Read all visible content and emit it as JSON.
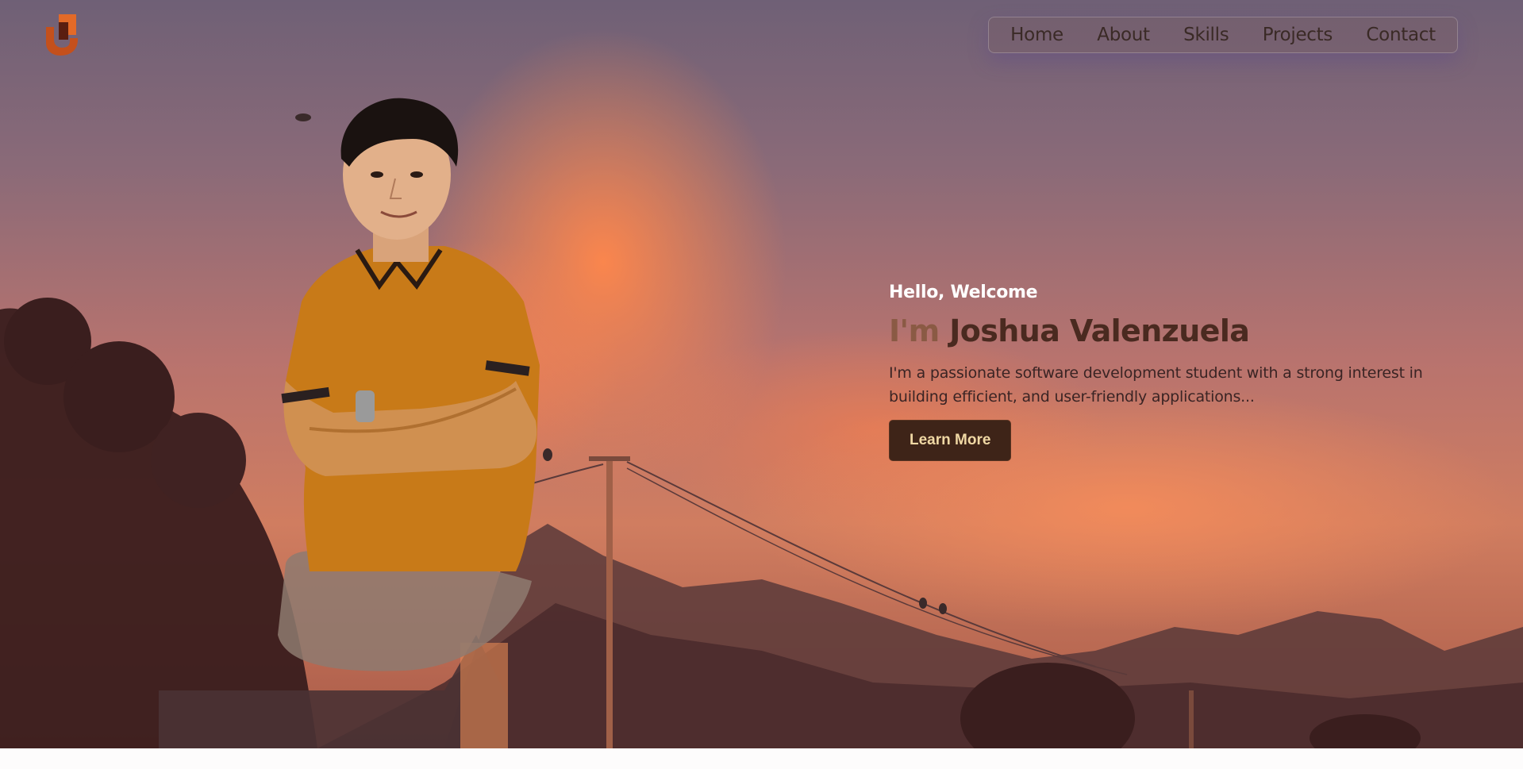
{
  "nav": {
    "items": [
      {
        "label": "Home"
      },
      {
        "label": "About"
      },
      {
        "label": "Skills"
      },
      {
        "label": "Projects"
      },
      {
        "label": "Contact"
      }
    ]
  },
  "logo": {
    "icon": "j-logo-icon",
    "color": "#d9531e"
  },
  "hero": {
    "greeting": "Hello, Welcome",
    "im": "I'm",
    "name": "Joshua Valenzuela",
    "description": "I'm a passionate software development student with a strong interest in building efficient, and user-friendly applications...",
    "cta_label": "Learn More"
  },
  "colors": {
    "accent": "#3e2418",
    "cta_text": "#f0d8a4",
    "name": "#4a2a20",
    "im": "#8a5a44"
  }
}
